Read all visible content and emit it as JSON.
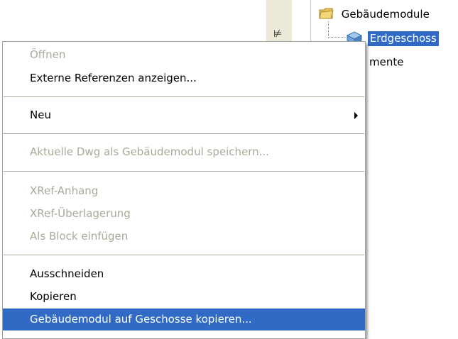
{
  "tree": {
    "root_label": "Gebäudemodule",
    "child_label": "Erdgeschoss",
    "partial_label": "mente",
    "pin_glyph": "⊭",
    "selection_color": "#316ac5"
  },
  "menu": {
    "items": [
      {
        "label": "Öffnen",
        "enabled": false
      },
      {
        "label": "Externe Referenzen anzeigen...",
        "enabled": true
      },
      {
        "label": "Neu",
        "enabled": true,
        "submenu": true
      },
      {
        "label": "Aktuelle Dwg als Gebäudemodul speichern...",
        "enabled": false
      },
      {
        "label": "XRef-Anhang",
        "enabled": false
      },
      {
        "label": "XRef-Überlagerung",
        "enabled": false
      },
      {
        "label": "Als Block einfügen",
        "enabled": false
      },
      {
        "label": "Ausschneiden",
        "enabled": true
      },
      {
        "label": "Kopieren",
        "enabled": true
      },
      {
        "label": "Gebäudemodul auf Geschosse kopieren...",
        "enabled": true,
        "selected": true
      }
    ],
    "disabled_color": "#aca899",
    "highlight_color": "#316ac5"
  }
}
